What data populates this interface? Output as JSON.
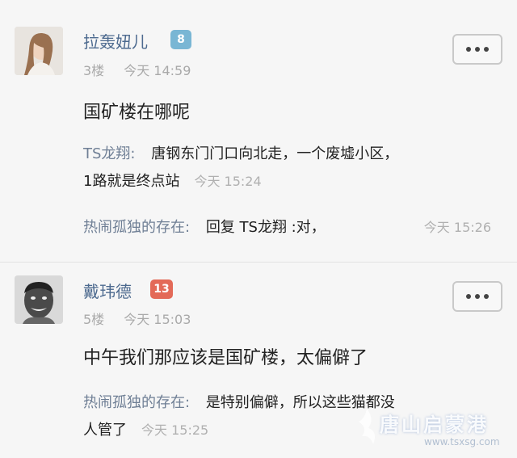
{
  "comments": [
    {
      "username": "拉轰妞儿",
      "level": "8",
      "level_color": "#79b6d4",
      "floor": "3楼",
      "time": "今天 14:59",
      "content": "国矿楼在哪呢",
      "replies": [
        {
          "author": "TS龙翔:",
          "text_line1": "唐钢东门门口向北走，一个废墟小区，",
          "text_line2": "1路就是终点站",
          "time": "今天 15:24"
        },
        {
          "author": "热闹孤独的存在:",
          "text": "回复 TS龙翔 :对，",
          "time": "今天 15:26"
        }
      ]
    },
    {
      "username": "戴玮德",
      "level": "13",
      "level_color": "#e36a58",
      "floor": "5楼",
      "time": "今天 15:03",
      "content": "中午我们那应该是国矿楼，太偏僻了",
      "replies": [
        {
          "author": "热闹孤独的存在:",
          "text_line1": "是特别偏僻，所以这些猫都没",
          "text_line2": "人管了",
          "time": "今天 15:25"
        }
      ]
    }
  ],
  "watermark": {
    "main": "唐山启蒙港",
    "sub": "www.tsxsg.com"
  },
  "icons": {
    "more": "more-dots-icon"
  }
}
